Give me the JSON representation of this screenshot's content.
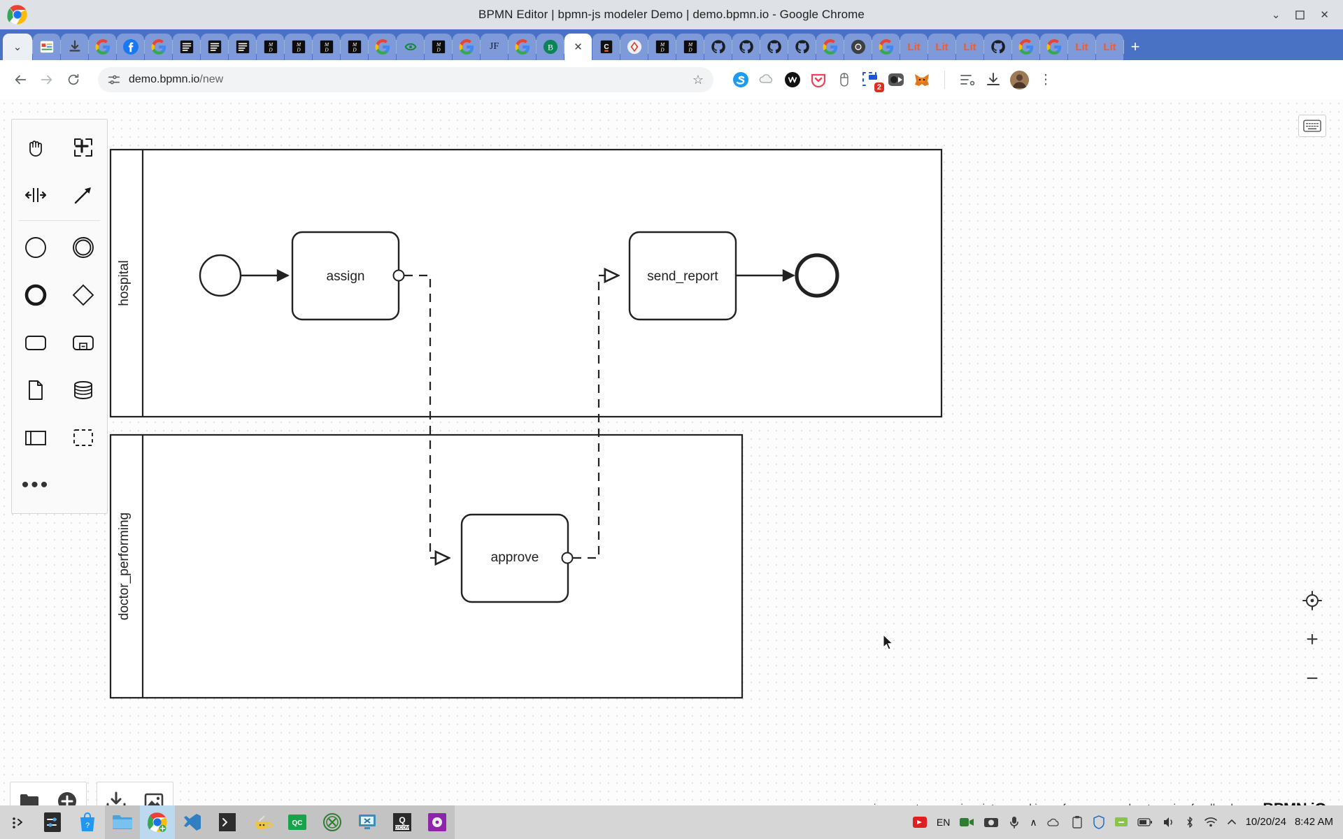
{
  "window": {
    "title": "BPMN Editor | bpmn-js modeler Demo | demo.bpmn.io - Google Chrome",
    "minimize": "⌄",
    "maximize": "⬜",
    "close": "✕"
  },
  "tabs": {
    "active_label": "",
    "active_close": "✕",
    "new_tab": "+",
    "items": [
      {
        "name": "tab-list-chevron",
        "kind": "chevron",
        "label": "⌄"
      },
      {
        "name": "tab-slides",
        "kind": "slides",
        "label": ""
      },
      {
        "name": "tab-download",
        "kind": "download",
        "label": ""
      },
      {
        "name": "tab-google-1",
        "kind": "google",
        "label": ""
      },
      {
        "name": "tab-facebook",
        "kind": "facebook",
        "label": ""
      },
      {
        "name": "tab-google-2",
        "kind": "google",
        "label": ""
      },
      {
        "name": "tab-doc-1",
        "kind": "doc",
        "label": ""
      },
      {
        "name": "tab-doc-2",
        "kind": "doc",
        "label": ""
      },
      {
        "name": "tab-doc-3",
        "kind": "doc",
        "label": ""
      },
      {
        "name": "tab-md-1",
        "kind": "md",
        "label": ""
      },
      {
        "name": "tab-md-2",
        "kind": "md",
        "label": ""
      },
      {
        "name": "tab-md-3",
        "kind": "md",
        "label": ""
      },
      {
        "name": "tab-md-4",
        "kind": "md",
        "label": ""
      },
      {
        "name": "tab-google-3",
        "kind": "google",
        "label": ""
      },
      {
        "name": "tab-overleaf",
        "kind": "overleaf",
        "label": ""
      },
      {
        "name": "tab-md-5",
        "kind": "md",
        "label": ""
      },
      {
        "name": "tab-google-4",
        "kind": "google",
        "label": ""
      },
      {
        "name": "tab-jotform",
        "kind": "initials",
        "label": "JF"
      },
      {
        "name": "tab-google-5",
        "kind": "google",
        "label": ""
      },
      {
        "name": "tab-bitwarden",
        "kind": "green-b",
        "label": ""
      },
      {
        "name": "tab-bpmn-active",
        "kind": "active",
        "label": ""
      },
      {
        "name": "tab-coursera",
        "kind": "dark-c",
        "label": ""
      },
      {
        "name": "tab-jetbrains",
        "kind": "diamond",
        "label": ""
      },
      {
        "name": "tab-md-6",
        "kind": "md",
        "label": ""
      },
      {
        "name": "tab-md-7",
        "kind": "md",
        "label": ""
      },
      {
        "name": "tab-github-1",
        "kind": "github",
        "label": ""
      },
      {
        "name": "tab-github-2",
        "kind": "github",
        "label": ""
      },
      {
        "name": "tab-github-3",
        "kind": "github",
        "label": ""
      },
      {
        "name": "tab-github-4",
        "kind": "github",
        "label": ""
      },
      {
        "name": "tab-google-6",
        "kind": "google",
        "label": ""
      },
      {
        "name": "tab-chromium",
        "kind": "chromium",
        "label": ""
      },
      {
        "name": "tab-google-7",
        "kind": "google",
        "label": ""
      },
      {
        "name": "tab-lit-1",
        "kind": "lit",
        "label": "Lit"
      },
      {
        "name": "tab-lit-2",
        "kind": "lit",
        "label": "Lit"
      },
      {
        "name": "tab-lit-3",
        "kind": "lit",
        "label": "Lit"
      },
      {
        "name": "tab-github-5",
        "kind": "github",
        "label": ""
      },
      {
        "name": "tab-google-8",
        "kind": "google",
        "label": ""
      },
      {
        "name": "tab-google-9",
        "kind": "google",
        "label": ""
      },
      {
        "name": "tab-lit-4",
        "kind": "lit",
        "label": "Lit"
      },
      {
        "name": "tab-lit-5",
        "kind": "lit",
        "label": "Lit"
      }
    ]
  },
  "toolbar": {
    "back": "←",
    "forward": "→",
    "reload": "↻",
    "url_host": "demo.bpmn.io",
    "url_path": "/new",
    "url_full": "demo.bpmn.io/new",
    "bookmark_star": "☆",
    "extension_badge": "2",
    "menu": "⋮",
    "extensions": [
      {
        "name": "extension-skype-icon"
      },
      {
        "name": "extension-cloud-icon"
      },
      {
        "name": "extension-wappalyzer-icon"
      },
      {
        "name": "extension-pocket-icon"
      },
      {
        "name": "extension-mouse-icon"
      },
      {
        "name": "extension-screenshot-icon",
        "badge": "2"
      },
      {
        "name": "extension-loom-icon"
      },
      {
        "name": "extension-metamask-icon"
      },
      {
        "name": "extension-camera-icon"
      }
    ],
    "right_icons": [
      {
        "name": "reading-list-icon"
      },
      {
        "name": "downloads-icon"
      },
      {
        "name": "profile-avatar"
      }
    ]
  },
  "palette": {
    "tools": [
      {
        "name": "hand-tool-icon",
        "label": "Activate hand tool"
      },
      {
        "name": "lasso-tool-icon",
        "label": "Activate lasso tool"
      },
      {
        "name": "space-tool-icon",
        "label": "Activate create/remove space tool"
      },
      {
        "name": "connect-tool-icon",
        "label": "Activate global connect tool"
      }
    ],
    "elements": [
      {
        "name": "start-event-icon",
        "label": "Create StartEvent"
      },
      {
        "name": "intermediate-event-icon",
        "label": "Create Intermediate/Boundary Event"
      },
      {
        "name": "end-event-icon",
        "label": "Create EndEvent"
      },
      {
        "name": "gateway-icon",
        "label": "Create Gateway"
      },
      {
        "name": "task-icon",
        "label": "Create Task"
      },
      {
        "name": "subprocess-icon",
        "label": "Create expanded SubProcess"
      },
      {
        "name": "data-object-icon",
        "label": "Create DataObjectReference"
      },
      {
        "name": "data-store-icon",
        "label": "Create DataStoreReference"
      },
      {
        "name": "pool-icon",
        "label": "Create Pool/Participant"
      },
      {
        "name": "group-icon",
        "label": "Create Group"
      }
    ],
    "more": "•••"
  },
  "canvas": {
    "keyboard_button": "keyboard-shortcuts-icon",
    "zoom_reset": "⊕",
    "zoom_in": "+",
    "zoom_out": "−"
  },
  "diagram": {
    "type": "bpmn-collaboration",
    "pools": [
      {
        "id": "pool-hospital",
        "label": "hospital"
      },
      {
        "id": "pool-doctor",
        "label": "doctor_performing"
      }
    ],
    "elements": [
      {
        "id": "start-event",
        "type": "startEvent",
        "label": "",
        "pool": "hospital"
      },
      {
        "id": "task-assign",
        "type": "task",
        "label": "assign",
        "pool": "hospital"
      },
      {
        "id": "task-send-report",
        "type": "task",
        "label": "send_report",
        "pool": "hospital"
      },
      {
        "id": "end-event",
        "type": "endEvent",
        "label": "",
        "pool": "hospital"
      },
      {
        "id": "task-approve",
        "type": "task",
        "label": "approve",
        "pool": "doctor_performing"
      }
    ],
    "flows": [
      {
        "id": "flow-start-assign",
        "type": "sequenceFlow",
        "from": "start-event",
        "to": "task-assign"
      },
      {
        "id": "flow-send-end",
        "type": "sequenceFlow",
        "from": "task-send-report",
        "to": "end-event"
      },
      {
        "id": "msg-assign-approve",
        "type": "messageFlow",
        "from": "task-assign",
        "to": "task-approve"
      },
      {
        "id": "msg-approve-send",
        "type": "messageFlow",
        "from": "task-approve",
        "to": "task-send-report"
      }
    ]
  },
  "bottom_actions": [
    {
      "name": "open-file-button",
      "icon": "folder-icon"
    },
    {
      "name": "create-new-button",
      "icon": "plus-circle-icon"
    },
    {
      "name": "download-bpmn-button",
      "icon": "download-icon"
    },
    {
      "name": "download-image-button",
      "icon": "image-icon"
    }
  ],
  "footer": {
    "links": [
      {
        "name": "footer-link-privacy",
        "label": "privacy"
      },
      {
        "name": "footer-link-terms",
        "label": "terms"
      },
      {
        "name": "footer-link-imprint",
        "label": "imprint"
      },
      {
        "name": "footer-link-cookie-preferences",
        "label": "cookie preferences"
      },
      {
        "name": "footer-link-about",
        "label": "about"
      },
      {
        "name": "footer-link-give-feedback",
        "label": "give feedback"
      }
    ],
    "brand": "BPMN.iO"
  },
  "taskbar": {
    "items": [
      {
        "name": "taskbar-show-desktop",
        "icon": "dots-icon"
      },
      {
        "name": "taskbar-menu",
        "icon": "dark-menu-icon"
      },
      {
        "name": "taskbar-store",
        "icon": "blue-bag-icon"
      },
      {
        "name": "taskbar-file-explorer",
        "icon": "folder-icon"
      },
      {
        "name": "taskbar-chrome",
        "icon": "chrome-icon"
      },
      {
        "name": "taskbar-vscode",
        "icon": "vscode-icon"
      },
      {
        "name": "taskbar-terminal",
        "icon": "terminal-icon"
      },
      {
        "name": "taskbar-teapot",
        "icon": "teapot-icon"
      },
      {
        "name": "taskbar-qc",
        "icon": "qc-icon"
      },
      {
        "name": "taskbar-xming",
        "icon": "x-circle-icon"
      },
      {
        "name": "taskbar-remote",
        "icon": "monitor-x-icon"
      },
      {
        "name": "taskbar-dicom",
        "icon": "dicom-icon"
      },
      {
        "name": "taskbar-media",
        "icon": "purple-media-icon"
      }
    ],
    "tray": [
      {
        "name": "tray-recording-icon"
      },
      {
        "name": "tray-language",
        "label": "EN"
      },
      {
        "name": "tray-video-icon"
      },
      {
        "name": "tray-camera-icon"
      },
      {
        "name": "tray-mic-icon"
      },
      {
        "name": "tray-chevron-up-icon",
        "label": "∧"
      },
      {
        "name": "tray-onedrive-icon"
      },
      {
        "name": "tray-clipboard-icon"
      },
      {
        "name": "tray-shield-icon"
      },
      {
        "name": "tray-app-icon"
      },
      {
        "name": "tray-battery-icon"
      },
      {
        "name": "tray-volume-icon"
      },
      {
        "name": "tray-bluetooth-icon"
      },
      {
        "name": "tray-wifi-icon"
      },
      {
        "name": "tray-expand-icon"
      }
    ],
    "date": "10/20/24",
    "time": "8:42 AM"
  },
  "colors": {
    "tabstrip": "#4a72c4",
    "titlebar": "#dee1e6",
    "accent_red": "#d93025",
    "lit_orange": "#ff5722",
    "stroke": "#222222"
  }
}
